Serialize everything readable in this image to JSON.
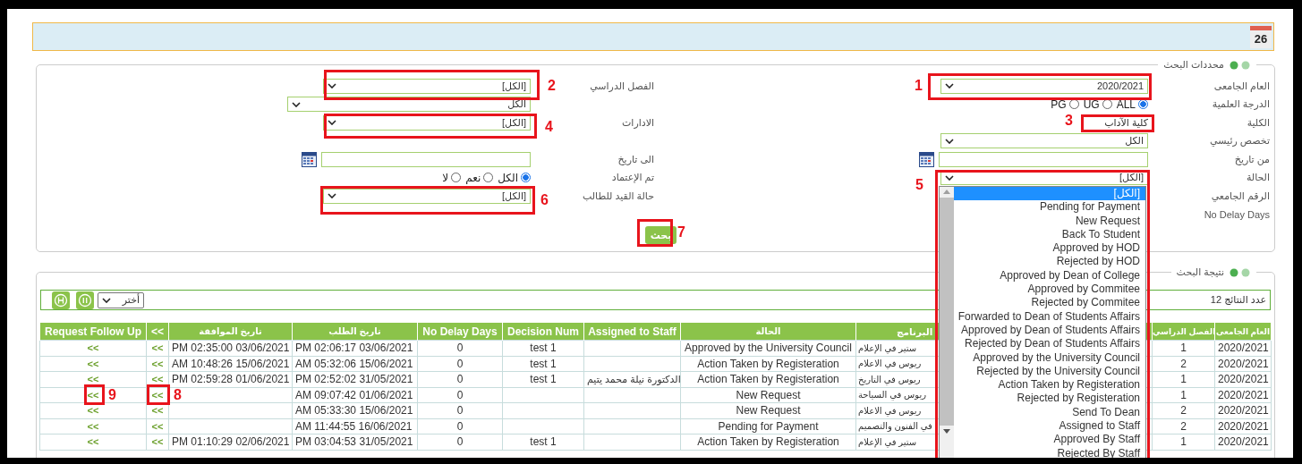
{
  "header": {
    "calendar_day": "26"
  },
  "search_panel": {
    "title": "محددات البحث",
    "rows": [
      {
        "right": {
          "label": "العام الجامعى",
          "kind": "select",
          "value": "2020/2021"
        },
        "left": {
          "label": "الفصل الدراسي",
          "kind": "select",
          "value": "[الكل]"
        }
      },
      {
        "right": {
          "label": "الدرجة العلمية",
          "kind": "radios",
          "options": [
            {
              "label": "ALL",
              "selected": true
            },
            {
              "label": "UG",
              "selected": false
            },
            {
              "label": "PG",
              "selected": false
            }
          ]
        },
        "left": {
          "kind": "select",
          "value": "الكل"
        }
      },
      {
        "right": {
          "label": "الكلية",
          "kind": "text",
          "value": "كلية الآداب"
        },
        "left": {
          "label": "الادارات",
          "kind": "select",
          "value": "[الكل]"
        }
      },
      {
        "right": {
          "label": "تخصص رئيسي",
          "kind": "select",
          "value": "الكل"
        }
      },
      {
        "right": {
          "label": "من تاريخ",
          "kind": "date"
        },
        "left": {
          "label": "الى تاريخ",
          "kind": "date"
        }
      },
      {
        "right": {
          "label": "الحالة",
          "kind": "select",
          "value": "[الكل]",
          "expanded": true,
          "options": [
            {
              "label": "[الكل]",
              "selected": true
            },
            {
              "label": "Pending for Payment",
              "selected": false
            },
            {
              "label": "New Request",
              "selected": false
            },
            {
              "label": "Back To Student",
              "selected": false
            },
            {
              "label": "Approved by HOD",
              "selected": false
            },
            {
              "label": "Rejected by HOD",
              "selected": false
            },
            {
              "label": "Approved by Dean of College",
              "selected": false
            },
            {
              "label": "Approved by Commitee",
              "selected": false
            },
            {
              "label": "Rejected by Commitee",
              "selected": false
            },
            {
              "label": "Forwarded to Dean of Students Affairs",
              "selected": false
            },
            {
              "label": "Approved by Dean of Students Affairs",
              "selected": false
            },
            {
              "label": "Rejected by Dean of Students Affairs",
              "selected": false
            },
            {
              "label": "Approved by the University Council",
              "selected": false
            },
            {
              "label": "Rejected by the University Council",
              "selected": false
            },
            {
              "label": "Action Taken by Registeration",
              "selected": false
            },
            {
              "label": "Rejected by Registeration",
              "selected": false
            },
            {
              "label": "Send To Dean",
              "selected": false
            },
            {
              "label": "Assigned to Staff",
              "selected": false
            },
            {
              "label": "Approved By Staff",
              "selected": false
            },
            {
              "label": "Rejected By Staff",
              "selected": false
            }
          ]
        },
        "left": {
          "label": "تم الإعتماد",
          "kind": "radios",
          "options": [
            {
              "label": "الكل",
              "selected": true
            },
            {
              "label": "نعم",
              "selected": false
            },
            {
              "label": "لا",
              "selected": false
            }
          ]
        }
      },
      {
        "right": {
          "label": "الرقم الجامعي",
          "kind": "label"
        },
        "left": {
          "label": "حالة القيد للطالب",
          "kind": "select",
          "value": "[الكل]"
        }
      },
      {
        "right": {
          "label": "No Delay Days",
          "kind": "label"
        }
      }
    ],
    "search_button": "بحث"
  },
  "results_panel": {
    "title": "نتيجة البحث",
    "view_select": "أختر",
    "count_label": "عدد النتائج 12",
    "columns": [
      "العام الجامعى",
      "الفصل الدراسي",
      "البرنامج",
      "الحالة",
      "Assigned to Staff",
      "Decision Num",
      "No Delay Days",
      "تاريخ الطلب",
      "تاريخ الموافقة",
      "<<",
      "Request Follow Up"
    ],
    "rows": [
      [
        "2020/2021",
        "1",
        "ستير في الإعلام",
        "Approved by the University Council",
        "",
        "test 1",
        "0",
        "PM 02:06:17 03/06/2021",
        "PM 02:35:00 03/06/2021",
        "<<",
        "<<"
      ],
      [
        "2020/2021",
        "2",
        "ريوس في الاعلام",
        "Action Taken by Registeration",
        "",
        "test 1",
        "0",
        "AM 05:32:06 15/06/2021",
        "AM 10:48:26 15/06/2021",
        "<<",
        "<<"
      ],
      [
        "2020/2021",
        "1",
        "ريوس في التاريخ",
        "Action Taken by Registeration",
        "الدكتورة نيلة محمد يتيم",
        "test 1",
        "0",
        "PM 02:52:02 31/05/2021",
        "PM 02:59:28 01/06/2021",
        "<<",
        "<<"
      ],
      [
        "2020/2021",
        "1",
        "ريوس في السياحة",
        "New Request",
        "",
        "",
        "0",
        "AM 09:07:42 01/06/2021",
        "",
        "<<",
        "<<"
      ],
      [
        "2020/2021",
        "2",
        "ريوس في الاعلام",
        "New Request",
        "",
        "",
        "0",
        "AM 05:33:30 15/06/2021",
        "",
        "<<",
        "<<"
      ],
      [
        "2020/2021",
        "2",
        "في الفنون والتصميم",
        "Pending for Payment",
        "",
        "",
        "0",
        "AM 11:44:55 16/06/2021",
        "",
        "<<",
        "<<"
      ],
      [
        "2020/2021",
        "1",
        "ستير في الإعلام",
        "Action Taken by Registeration",
        "",
        "test 1",
        "0",
        "PM 03:04:53 31/05/2021",
        "PM 01:10:29 02/06/2021",
        "<<",
        "<<"
      ]
    ]
  },
  "annotations": [
    "1",
    "2",
    "3",
    "4",
    "5",
    "6",
    "7",
    "8",
    "9"
  ]
}
